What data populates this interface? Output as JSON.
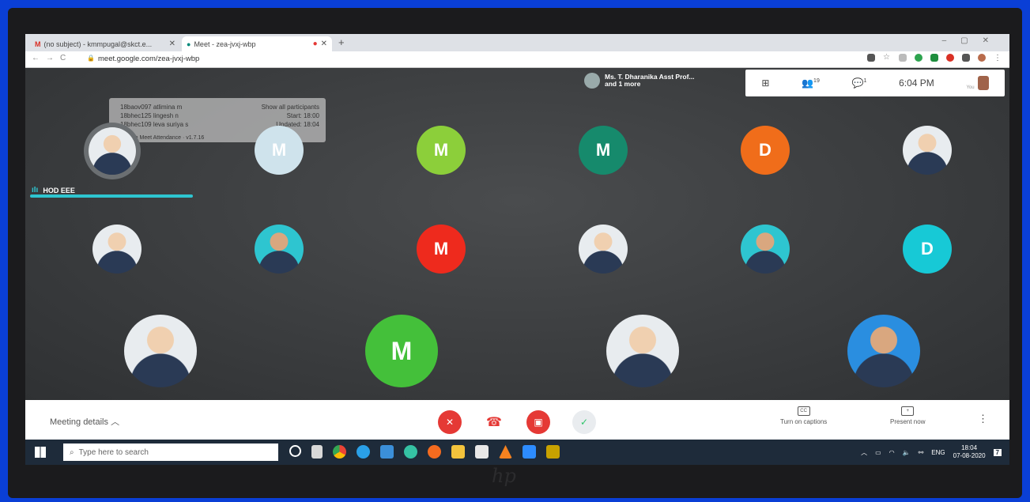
{
  "browser": {
    "tabs": [
      {
        "label": "(no subject) - kmmpugal@skct.e...",
        "icon": "gmail-icon"
      },
      {
        "label": "Meet - zea-jvxj-wbp",
        "icon": "meet-icon"
      }
    ],
    "url": "meet.google.com/zea-jvxj-wbp"
  },
  "meet": {
    "presenter": "Ms. T. Dharanika Asst Prof...",
    "presenter_sub": "and 1 more",
    "participant_count": "19",
    "chat_badge": "1",
    "time": "6:04 PM",
    "you_label": "You",
    "speaker_label": "HOD EEE",
    "popup_names": [
      "18baov097 atlimina m",
      "18bhec125 lingesh n",
      "18bhec109 leva suriya s"
    ],
    "popup_footer": "Google Meet Attendance · v1.7.16",
    "popup_buttons": [
      "Show all participants",
      "Start: 18:00",
      "Updated: 18:04"
    ],
    "tiles": [
      {
        "kind": "photo",
        "letter": "",
        "color": "#e8ecef"
      },
      {
        "kind": "letter",
        "letter": "M",
        "color": "#cfe3ec"
      },
      {
        "kind": "letter",
        "letter": "M",
        "color": "#8ccf3a"
      },
      {
        "kind": "letter",
        "letter": "M",
        "color": "#168a6c"
      },
      {
        "kind": "letter",
        "letter": "D",
        "color": "#f06d1a"
      },
      {
        "kind": "photo",
        "letter": "",
        "color": "#e8ecef"
      },
      {
        "kind": "photo",
        "letter": "",
        "color": "#e8ecef"
      },
      {
        "kind": "photo",
        "letter": "",
        "color": "#2ec5d0"
      },
      {
        "kind": "letter",
        "letter": "M",
        "color": "#ee2a1d"
      },
      {
        "kind": "photo",
        "letter": "",
        "color": "#e8ecef"
      },
      {
        "kind": "photo",
        "letter": "",
        "color": "#2ec5d0"
      },
      {
        "kind": "letter",
        "letter": "D",
        "color": "#17c9d6"
      },
      {
        "kind": "photo",
        "letter": "",
        "color": "#e8ecef"
      },
      {
        "kind": "letter",
        "letter": "M",
        "color": "#44c03a"
      },
      {
        "kind": "photo",
        "letter": "",
        "color": "#e8ecef"
      },
      {
        "kind": "photo",
        "letter": "",
        "color": "#2a8ee0"
      }
    ]
  },
  "controls": {
    "meeting_details": "Meeting details",
    "captions": "Turn on captions",
    "captions_icon": "CC",
    "present": "Present now",
    "present_icon": "+",
    "mic_color": "#e53935",
    "hangup_color": "#e53935",
    "cam_color": "#e53935",
    "check_color": "#2ec56a"
  },
  "taskbar": {
    "search_placeholder": "Type here to search",
    "lang": "ENG",
    "time": "18:04",
    "date": "07-08-2020",
    "notif": "7"
  },
  "bezel_logo": "hp"
}
